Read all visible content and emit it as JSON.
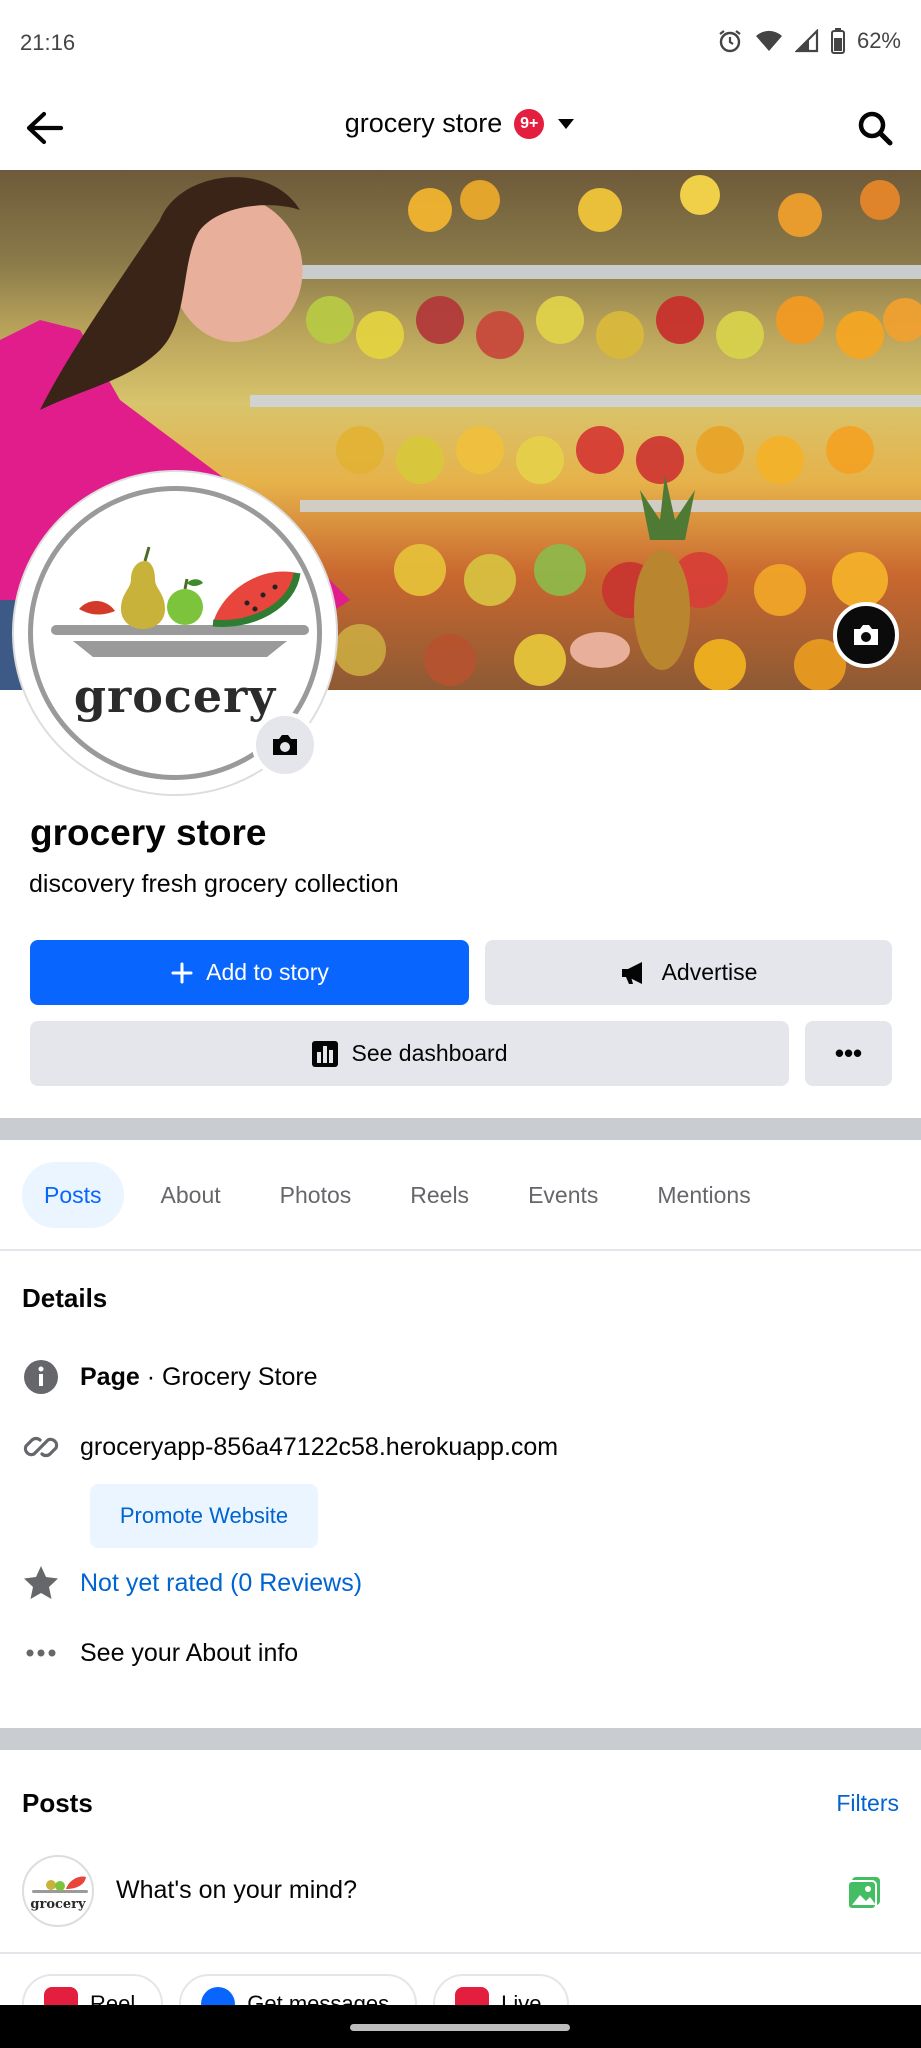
{
  "status_bar": {
    "time": "21:16",
    "battery": "62%",
    "icons": [
      "alarm-icon",
      "wifi-icon",
      "signal-icon",
      "battery-icon"
    ]
  },
  "topbar": {
    "title": "grocery store",
    "badge": "9+",
    "icons": [
      "back-arrow-icon",
      "chevron-down-icon",
      "search-icon"
    ]
  },
  "profile": {
    "avatar_word": "grocery",
    "name": "grocery store",
    "bio": "discovery fresh grocery collection"
  },
  "actions": {
    "add_to_story": "Add to story",
    "advertise": "Advertise",
    "see_dashboard": "See dashboard",
    "more": "•••"
  },
  "tabs": [
    {
      "label": "Posts",
      "active": true
    },
    {
      "label": "About",
      "active": false
    },
    {
      "label": "Photos",
      "active": false
    },
    {
      "label": "Reels",
      "active": false
    },
    {
      "label": "Events",
      "active": false
    },
    {
      "label": "Mentions",
      "active": false
    }
  ],
  "details": {
    "title": "Details",
    "page_label": "Page",
    "page_category": " · Grocery Store",
    "website": "groceryapp-856a47122c58.herokuapp.com",
    "promote_button": "Promote Website",
    "rating": "Not yet rated (0 Reviews)",
    "about_info": "See your About info"
  },
  "posts": {
    "title": "Posts",
    "filters": "Filters",
    "composer_placeholder": "What's on your mind?",
    "chips": [
      "Reel",
      "Get messages",
      "Live"
    ]
  },
  "colors": {
    "accent": "#0866ff",
    "link": "#0064d1",
    "badge": "#e41e3f",
    "button_gray": "#e4e6eb"
  }
}
